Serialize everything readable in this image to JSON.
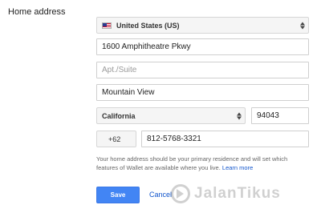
{
  "form": {
    "section_label": "Home address",
    "country": {
      "value": "United States (US)",
      "flag_icon": "us-flag-icon"
    },
    "street": {
      "value": "1600 Amphitheatre Pkwy"
    },
    "apt": {
      "placeholder": "Apt./Suite"
    },
    "city": {
      "value": "Mountain View"
    },
    "state": {
      "value": "California"
    },
    "zip": {
      "value": "94043"
    },
    "phone_code": {
      "value": "+62"
    },
    "phone": {
      "value": "812-5768-3321"
    },
    "help": {
      "text": "Your home address should be your primary residence and will set which features of Wallet are available where you live.",
      "link": "Learn more"
    }
  },
  "actions": {
    "save_label": "Save",
    "cancel_label": "Cancel"
  },
  "watermark": {
    "text": "JalanTikus"
  },
  "colors": {
    "primary": "#4285f4",
    "link": "#1155cc"
  }
}
